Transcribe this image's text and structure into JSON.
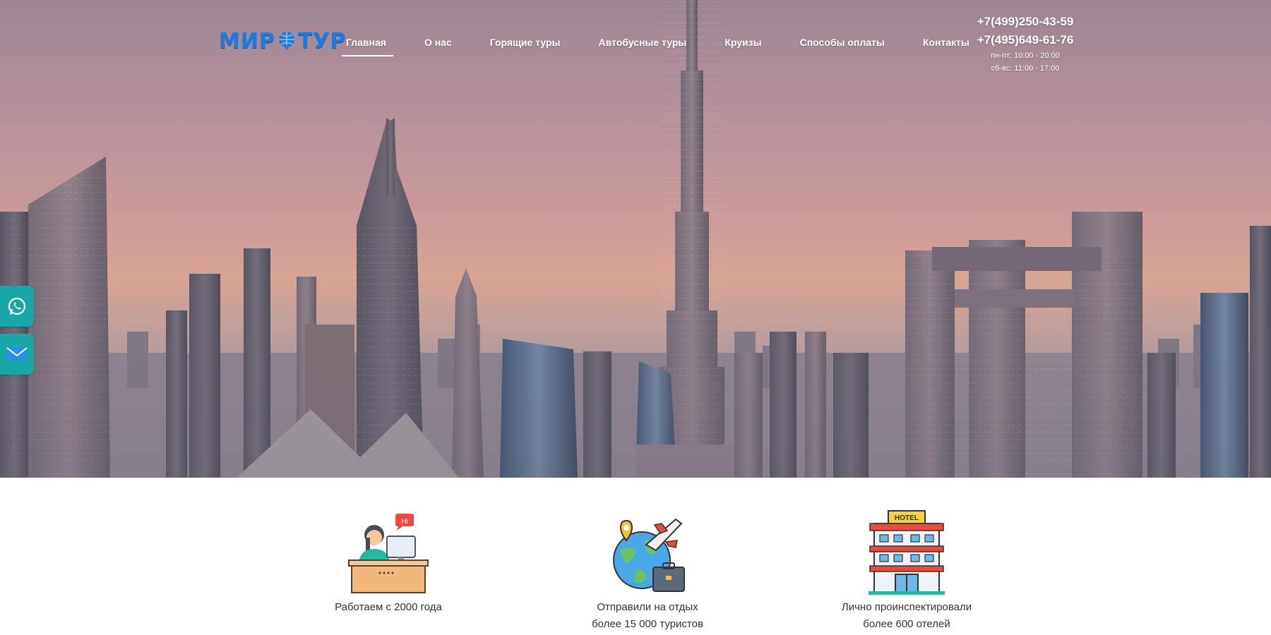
{
  "logo": {
    "text_left": "МИР",
    "text_right": "ТУР"
  },
  "nav": {
    "items": [
      "Главная",
      "О нас",
      "Горящие туры",
      "Автобусные туры",
      "Круизы",
      "Способы оплаты",
      "Контакты"
    ],
    "active_index": 0
  },
  "contacts": {
    "phone1": "+7(499)250-43-59",
    "phone2": "+7(495)649-61-76",
    "hours_weekdays": "пн-пт: 10:00 - 20:00",
    "hours_weekend": "сб-вс: 11:00 - 17:00"
  },
  "side_buttons": {
    "whatsapp_icon": "whatsapp-icon",
    "mail_icon": "mail-icon"
  },
  "features": [
    {
      "icon": "agent-desk-icon",
      "line1": "Работаем с 2000 года",
      "line2": "",
      "bubble": "Hi"
    },
    {
      "icon": "globe-plane-icon",
      "line1": "Отправили на отдых",
      "line2": "более 15 000 туристов"
    },
    {
      "icon": "hotel-icon",
      "line1": "Лично проинспектировали",
      "line2": "более 600 отелей",
      "sign": "HOTEL"
    }
  ],
  "colors": {
    "accent": "#17a7a7",
    "logo": "#1f7ad9",
    "text": "#333333"
  }
}
